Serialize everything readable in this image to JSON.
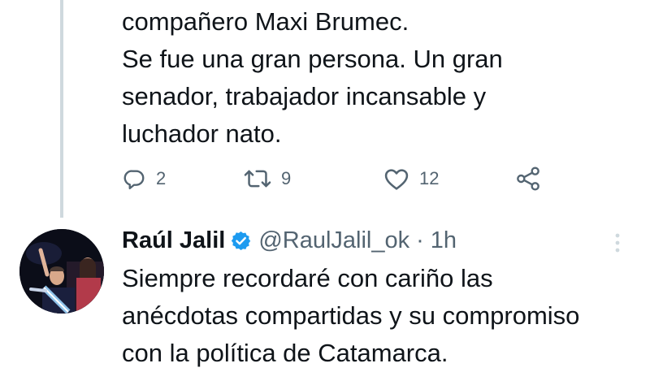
{
  "tweet_previous": {
    "lines": [
      "compañero Maxi Brumec.",
      "Se fue una gran persona. Un gran",
      "senador, trabajador incansable y",
      "luchador nato."
    ],
    "actions": {
      "replies": "2",
      "retweets": "9",
      "likes": "12"
    }
  },
  "tweet_reply": {
    "author_name": "Raúl Jalil",
    "handle": "@RaulJalil_ok",
    "separator": "·",
    "time": "1h",
    "lines": [
      "Siempre recordaré con cariño las",
      "anécdotas compartidas y su compromiso",
      "con la política de Catamarca."
    ]
  },
  "icons": {
    "reply": "reply-icon",
    "retweet": "retweet-icon",
    "like": "heart-icon",
    "share": "share-icon",
    "verified": "verified-badge-icon",
    "more": "more-vertical-icon"
  },
  "colors": {
    "text": "#0f1419",
    "secondary": "#536471",
    "verified": "#1d9bf0",
    "thread_line": "#cfd9de"
  }
}
